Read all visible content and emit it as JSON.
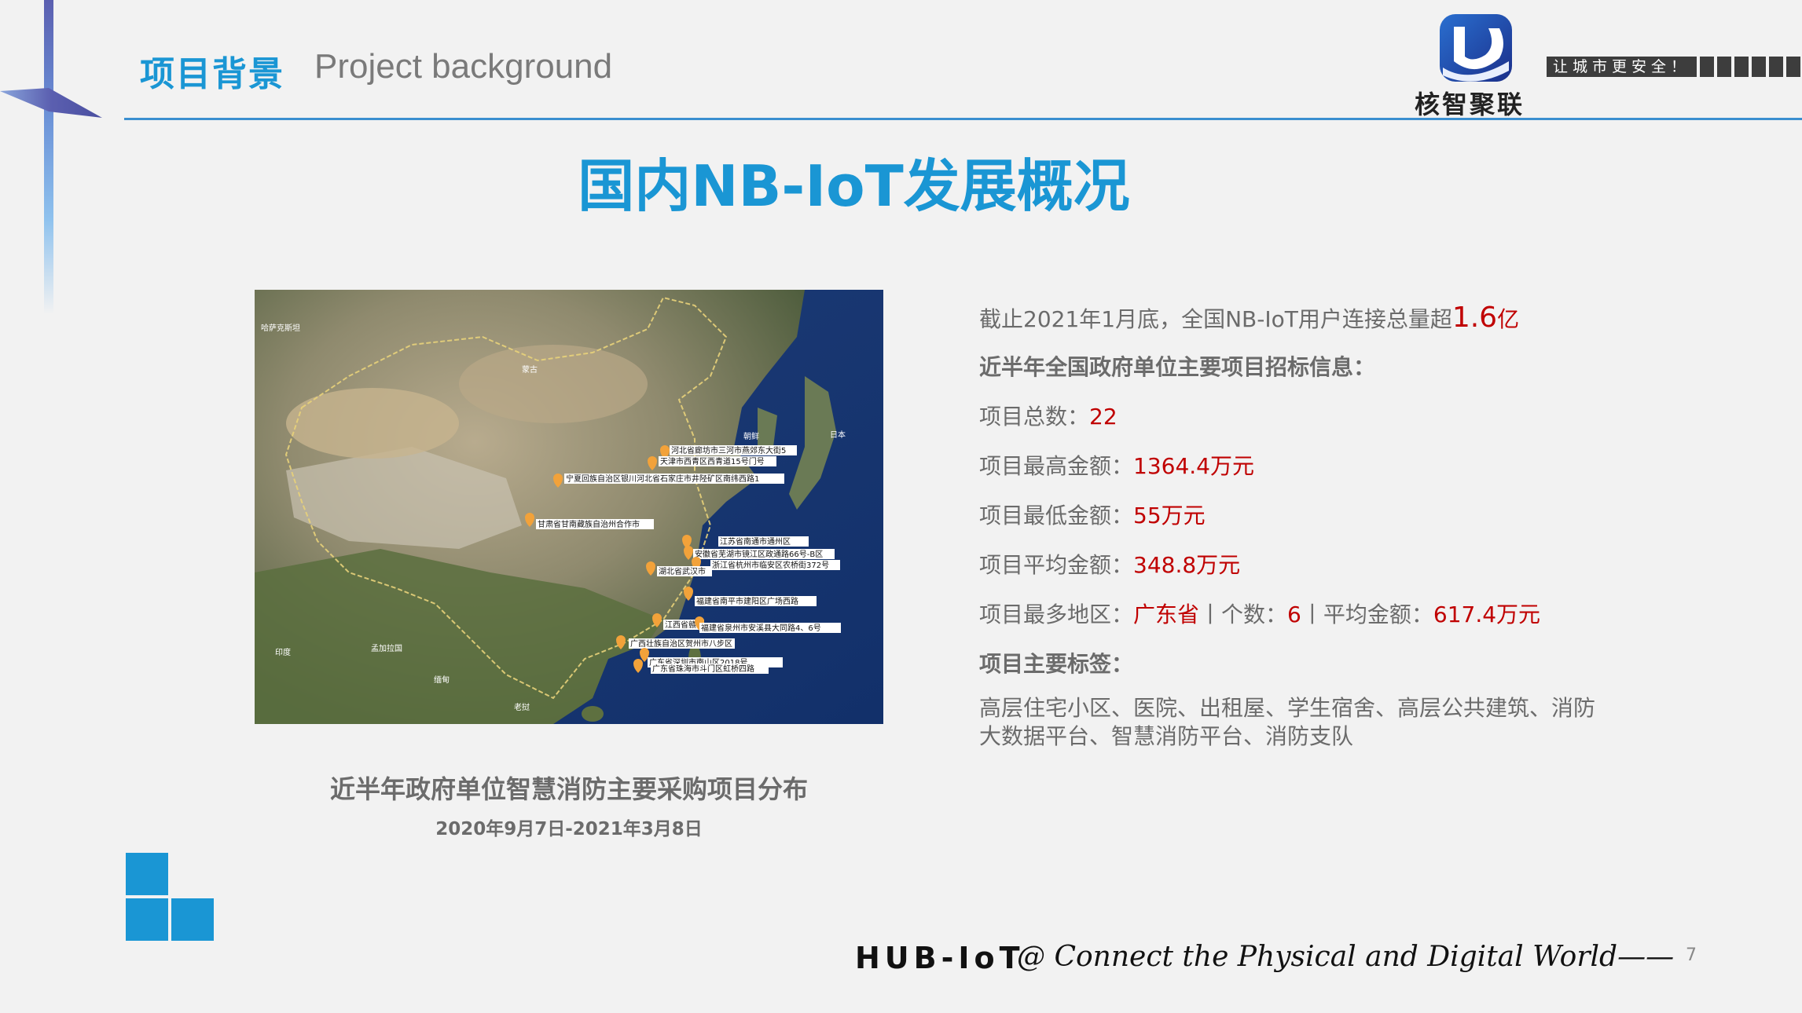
{
  "header": {
    "section_cn": "项目背景",
    "section_en": "Project background",
    "brand_name": "核智聚联",
    "slogan": "让城市更安全！"
  },
  "title": "国内NB-IoT发展概况",
  "map": {
    "labels": {
      "kazakhstan": "哈萨克斯坦",
      "mongolia": "蒙古",
      "korea": "朝鲜",
      "japan": "日本",
      "india": "印度",
      "bangladesh": "孟加拉国",
      "myanmar": "缅甸",
      "laos": "老挝"
    },
    "markers": [
      "河北省廊坊市三河市燕郊东大街5",
      "天津市西青区西青道15号门号",
      "宁夏回族自治区银川河北省石家庄市井陉矿区南纬西路1",
      "甘肃省甘南藏族自治州合作市",
      "江苏省南通市通州区",
      "安徽省芜湖市镜江区政通路66号-B区",
      "浙江省杭州市临安区农桥街372号",
      "湖北省武汉市",
      "福建省南平市建阳区广场西路",
      "江西省赣",
      "福建省泉州市安溪县大同路4、6号",
      "广西壮族自治区贺州市八步区",
      "广东省深圳市南山区2018号",
      "广东省珠海市斗门区虹桥四路"
    ],
    "caption": "近半年政府单位智慧消防主要采购项目分布",
    "date_range": "2020年9月7日-2021年3月8日"
  },
  "info": {
    "summary_prefix": "截止2021年1月底，全国NB-IoT用户连接总量超",
    "summary_value": "1.6",
    "summary_unit": "亿",
    "heading": "近半年全国政府单位主要项目招标信息：",
    "total_label": "项目总数：",
    "total_value": "22",
    "max_label": "项目最高金额：",
    "max_value": "1364.4万元",
    "min_label": "项目最低金额：",
    "min_value": "55万元",
    "avg_label": "项目平均金额：",
    "avg_value": "348.8万元",
    "region_label": "项目最多地区：",
    "region_value": "广东省",
    "count_label": "丨个数：",
    "count_value": "6",
    "region_avg_label": "丨平均金额：",
    "region_avg_value": "617.4万元",
    "tags_heading": "项目主要标签：",
    "tags_text": "高层住宅小区、医院、出租屋、学生宿舍、高层公共建筑、消防大数据平台、智慧消防平台、消防支队"
  },
  "footer": {
    "brand": "HUB-IoT",
    "tagline": "@ Connect the Physical and Digital World——",
    "page_number": "7"
  },
  "colors": {
    "accent_blue": "#1a96d4",
    "highlight_red": "#c00000",
    "body_gray": "#6b6b6b",
    "marker_orange": "#f2a23a"
  }
}
